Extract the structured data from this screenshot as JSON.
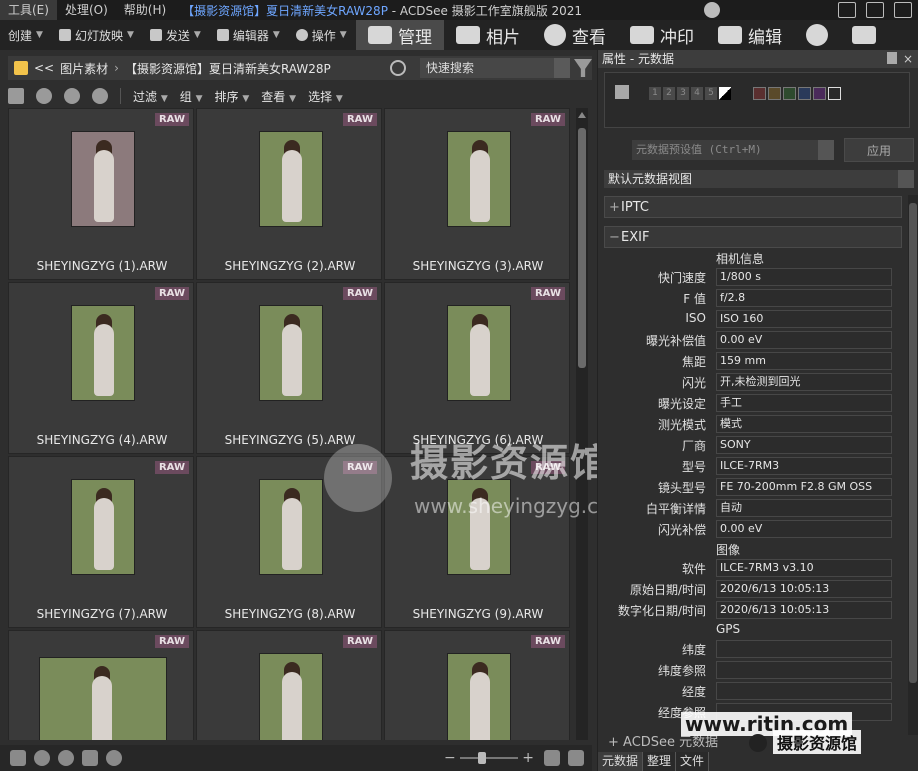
{
  "menubar": {
    "items": [
      "工具(E)",
      "处理(O)",
      "帮助(H)"
    ],
    "title_prefix": "【摄影资源馆】夏日清新美女RAW28P",
    "title_suffix": " - ACDSee 摄影工作室旗舰版 2021"
  },
  "toolbar": {
    "create": "创建",
    "slideshow": "幻灯放映",
    "send": "发送",
    "editor": "编辑器",
    "actions": "操作"
  },
  "modes": [
    "管理",
    "相片",
    "查看",
    "冲印",
    "编辑"
  ],
  "path": {
    "back": "<<",
    "crumb1": "图片素材",
    "crumb2": "【摄影资源馆】夏日清新美女RAW28P",
    "search_placeholder": "快速搜索"
  },
  "subbar": [
    "过滤",
    "组",
    "排序",
    "查看",
    "选择"
  ],
  "thumbnails": [
    {
      "name": "SHEYINGZYG (1).ARW",
      "badge": "RAW"
    },
    {
      "name": "SHEYINGZYG (2).ARW",
      "badge": "RAW"
    },
    {
      "name": "SHEYINGZYG (3).ARW",
      "badge": "RAW"
    },
    {
      "name": "SHEYINGZYG (4).ARW",
      "badge": "RAW"
    },
    {
      "name": "SHEYINGZYG (5).ARW",
      "badge": "RAW"
    },
    {
      "name": "SHEYINGZYG (6).ARW",
      "badge": "RAW"
    },
    {
      "name": "SHEYINGZYG (7).ARW",
      "badge": "RAW"
    },
    {
      "name": "SHEYINGZYG (8).ARW",
      "badge": "RAW"
    },
    {
      "name": "SHEYINGZYG (9).ARW",
      "badge": "RAW"
    },
    {
      "name": "",
      "badge": "RAW"
    },
    {
      "name": "",
      "badge": "RAW"
    },
    {
      "name": "",
      "badge": "RAW"
    }
  ],
  "watermark": {
    "cn": "摄影资源馆",
    "url": "www.sheyingzyg.com"
  },
  "panel": {
    "title": "属性 - 元数据",
    "close": "×",
    "ratings": [
      "1",
      "2",
      "3",
      "4",
      "5"
    ],
    "preset_placeholder": "元数据预设值 (Ctrl+M)",
    "apply": "应用",
    "view": "默认元数据视图",
    "iptc": "IPTC",
    "exif": "EXIF",
    "group_camera": "相机信息",
    "group_image": "图像",
    "group_gps": "GPS",
    "fields": [
      {
        "k": "快门速度",
        "v": "1/800 s"
      },
      {
        "k": "F 值",
        "v": "f/2.8"
      },
      {
        "k": "ISO",
        "v": "ISO 160"
      },
      {
        "k": "曝光补偿值",
        "v": "0.00 eV"
      },
      {
        "k": "焦距",
        "v": "159 mm"
      },
      {
        "k": "闪光",
        "v": "开,未检测到回光"
      },
      {
        "k": "曝光设定",
        "v": "手工"
      },
      {
        "k": "测光模式",
        "v": "模式"
      },
      {
        "k": "厂商",
        "v": "SONY"
      },
      {
        "k": "型号",
        "v": "ILCE-7RM3"
      },
      {
        "k": "镜头型号",
        "v": "FE 70-200mm F2.8 GM OSS"
      },
      {
        "k": "白平衡详情",
        "v": "自动"
      },
      {
        "k": "闪光补偿",
        "v": "0.00 eV"
      }
    ],
    "image_fields": [
      {
        "k": "软件",
        "v": "ILCE-7RM3 v3.10"
      },
      {
        "k": "原始日期/时间",
        "v": "2020/6/13 10:05:13"
      },
      {
        "k": "数字化日期/时间",
        "v": "2020/6/13 10:05:13"
      }
    ],
    "gps_fields": [
      {
        "k": "纬度",
        "v": ""
      },
      {
        "k": "纬度参照",
        "v": ""
      },
      {
        "k": "经度",
        "v": ""
      },
      {
        "k": "经度参照",
        "v": ""
      }
    ],
    "acdsee_section": "ACDSee 元数据",
    "tabs": [
      "元数据",
      "整理",
      "文件"
    ]
  },
  "watermark2": {
    "url": "www.ritin.com",
    "cn": "摄影资源馆"
  }
}
